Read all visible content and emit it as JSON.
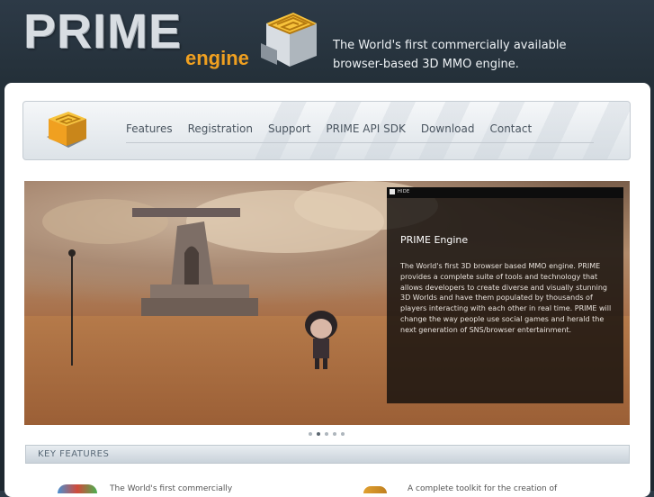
{
  "header": {
    "logo_word": "PRIME",
    "logo_sub": "engine",
    "tagline_line1": "The World's first commercially available",
    "tagline_line2": "browser-based 3D MMO engine."
  },
  "nav": {
    "items": [
      {
        "label": "Features"
      },
      {
        "label": "Registration"
      },
      {
        "label": "Support"
      },
      {
        "label": "PRIME API SDK"
      },
      {
        "label": "Download"
      },
      {
        "label": "Contact"
      }
    ]
  },
  "slider": {
    "hide_label": "HIDE",
    "title": "PRIME Engine",
    "text": "The World's first 3D browser based MMO engine. PRIME provides a complete suite of tools and technology that allows developers to create diverse and visually stunning 3D Worlds and have them populated by thousands of players interacting with each other in real time. PRIME will change the way people use social games and herald the next generation of SNS/browser entertainment.",
    "dot_count": 5,
    "active_dot": 2
  },
  "key_features": {
    "heading": "KEY FEATURES",
    "item1_text": "The World's first commercially",
    "item2_text": "A complete toolkit for the creation of"
  },
  "colors": {
    "accent": "#f0a020",
    "header_bg": "#2d3a47",
    "nav_text": "#4a5560"
  }
}
